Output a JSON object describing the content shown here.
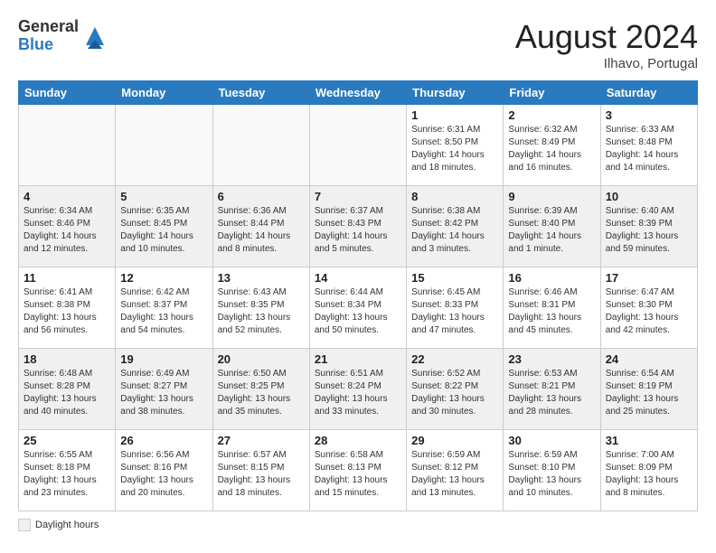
{
  "header": {
    "logo_general": "General",
    "logo_blue": "Blue",
    "month_title": "August 2024",
    "location": "Ilhavo, Portugal"
  },
  "days_of_week": [
    "Sunday",
    "Monday",
    "Tuesday",
    "Wednesday",
    "Thursday",
    "Friday",
    "Saturday"
  ],
  "weeks": [
    [
      {
        "day": "",
        "info": "",
        "empty": true
      },
      {
        "day": "",
        "info": "",
        "empty": true
      },
      {
        "day": "",
        "info": "",
        "empty": true
      },
      {
        "day": "",
        "info": "",
        "empty": true
      },
      {
        "day": "1",
        "info": "Sunrise: 6:31 AM\nSunset: 8:50 PM\nDaylight: 14 hours\nand 18 minutes."
      },
      {
        "day": "2",
        "info": "Sunrise: 6:32 AM\nSunset: 8:49 PM\nDaylight: 14 hours\nand 16 minutes."
      },
      {
        "day": "3",
        "info": "Sunrise: 6:33 AM\nSunset: 8:48 PM\nDaylight: 14 hours\nand 14 minutes."
      }
    ],
    [
      {
        "day": "4",
        "info": "Sunrise: 6:34 AM\nSunset: 8:46 PM\nDaylight: 14 hours\nand 12 minutes.",
        "shaded": true
      },
      {
        "day": "5",
        "info": "Sunrise: 6:35 AM\nSunset: 8:45 PM\nDaylight: 14 hours\nand 10 minutes.",
        "shaded": true
      },
      {
        "day": "6",
        "info": "Sunrise: 6:36 AM\nSunset: 8:44 PM\nDaylight: 14 hours\nand 8 minutes.",
        "shaded": true
      },
      {
        "day": "7",
        "info": "Sunrise: 6:37 AM\nSunset: 8:43 PM\nDaylight: 14 hours\nand 5 minutes.",
        "shaded": true
      },
      {
        "day": "8",
        "info": "Sunrise: 6:38 AM\nSunset: 8:42 PM\nDaylight: 14 hours\nand 3 minutes.",
        "shaded": true
      },
      {
        "day": "9",
        "info": "Sunrise: 6:39 AM\nSunset: 8:40 PM\nDaylight: 14 hours\nand 1 minute.",
        "shaded": true
      },
      {
        "day": "10",
        "info": "Sunrise: 6:40 AM\nSunset: 8:39 PM\nDaylight: 13 hours\nand 59 minutes.",
        "shaded": true
      }
    ],
    [
      {
        "day": "11",
        "info": "Sunrise: 6:41 AM\nSunset: 8:38 PM\nDaylight: 13 hours\nand 56 minutes."
      },
      {
        "day": "12",
        "info": "Sunrise: 6:42 AM\nSunset: 8:37 PM\nDaylight: 13 hours\nand 54 minutes."
      },
      {
        "day": "13",
        "info": "Sunrise: 6:43 AM\nSunset: 8:35 PM\nDaylight: 13 hours\nand 52 minutes."
      },
      {
        "day": "14",
        "info": "Sunrise: 6:44 AM\nSunset: 8:34 PM\nDaylight: 13 hours\nand 50 minutes."
      },
      {
        "day": "15",
        "info": "Sunrise: 6:45 AM\nSunset: 8:33 PM\nDaylight: 13 hours\nand 47 minutes."
      },
      {
        "day": "16",
        "info": "Sunrise: 6:46 AM\nSunset: 8:31 PM\nDaylight: 13 hours\nand 45 minutes."
      },
      {
        "day": "17",
        "info": "Sunrise: 6:47 AM\nSunset: 8:30 PM\nDaylight: 13 hours\nand 42 minutes."
      }
    ],
    [
      {
        "day": "18",
        "info": "Sunrise: 6:48 AM\nSunset: 8:28 PM\nDaylight: 13 hours\nand 40 minutes.",
        "shaded": true
      },
      {
        "day": "19",
        "info": "Sunrise: 6:49 AM\nSunset: 8:27 PM\nDaylight: 13 hours\nand 38 minutes.",
        "shaded": true
      },
      {
        "day": "20",
        "info": "Sunrise: 6:50 AM\nSunset: 8:25 PM\nDaylight: 13 hours\nand 35 minutes.",
        "shaded": true
      },
      {
        "day": "21",
        "info": "Sunrise: 6:51 AM\nSunset: 8:24 PM\nDaylight: 13 hours\nand 33 minutes.",
        "shaded": true
      },
      {
        "day": "22",
        "info": "Sunrise: 6:52 AM\nSunset: 8:22 PM\nDaylight: 13 hours\nand 30 minutes.",
        "shaded": true
      },
      {
        "day": "23",
        "info": "Sunrise: 6:53 AM\nSunset: 8:21 PM\nDaylight: 13 hours\nand 28 minutes.",
        "shaded": true
      },
      {
        "day": "24",
        "info": "Sunrise: 6:54 AM\nSunset: 8:19 PM\nDaylight: 13 hours\nand 25 minutes.",
        "shaded": true
      }
    ],
    [
      {
        "day": "25",
        "info": "Sunrise: 6:55 AM\nSunset: 8:18 PM\nDaylight: 13 hours\nand 23 minutes."
      },
      {
        "day": "26",
        "info": "Sunrise: 6:56 AM\nSunset: 8:16 PM\nDaylight: 13 hours\nand 20 minutes."
      },
      {
        "day": "27",
        "info": "Sunrise: 6:57 AM\nSunset: 8:15 PM\nDaylight: 13 hours\nand 18 minutes."
      },
      {
        "day": "28",
        "info": "Sunrise: 6:58 AM\nSunset: 8:13 PM\nDaylight: 13 hours\nand 15 minutes."
      },
      {
        "day": "29",
        "info": "Sunrise: 6:59 AM\nSunset: 8:12 PM\nDaylight: 13 hours\nand 13 minutes."
      },
      {
        "day": "30",
        "info": "Sunrise: 6:59 AM\nSunset: 8:10 PM\nDaylight: 13 hours\nand 10 minutes."
      },
      {
        "day": "31",
        "info": "Sunrise: 7:00 AM\nSunset: 8:09 PM\nDaylight: 13 hours\nand 8 minutes."
      }
    ]
  ],
  "legend": {
    "shaded_label": "Daylight hours"
  }
}
